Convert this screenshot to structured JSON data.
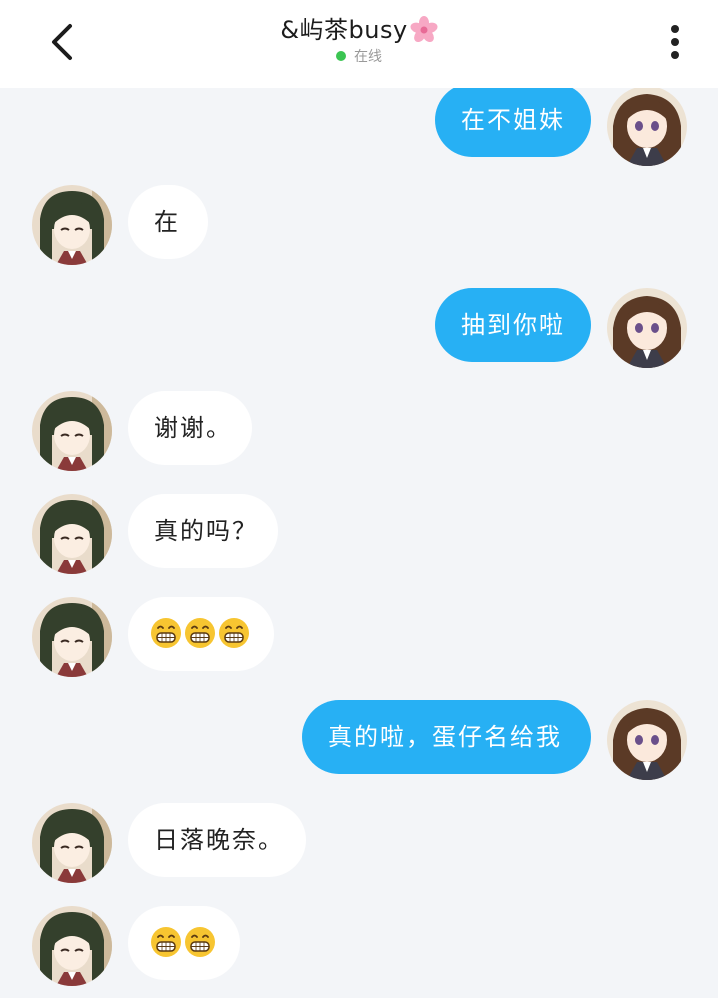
{
  "header": {
    "contact_name": "&屿茶busy",
    "status": "在线",
    "accent_online": "#3bc552",
    "icons": [
      "back-arrow-icon",
      "cherry-blossom-icon",
      "more-vertical-icon"
    ]
  },
  "messages": [
    {
      "side": "out",
      "text": "在不姐妹"
    },
    {
      "side": "in",
      "text": "在"
    },
    {
      "side": "out",
      "text": "抽到你啦"
    },
    {
      "side": "in",
      "text": "谢谢。"
    },
    {
      "side": "in",
      "text": "真的吗？"
    },
    {
      "side": "in",
      "text": "",
      "emoji": [
        "grinning-face-emoji",
        "grinning-face-emoji",
        "grinning-face-emoji"
      ]
    },
    {
      "side": "out",
      "text": "真的啦，蛋仔名给我"
    },
    {
      "side": "in",
      "text": "日落晚奈。"
    },
    {
      "side": "in",
      "text": "",
      "emoji": [
        "grinning-face-emoji",
        "grinning-face-emoji"
      ]
    }
  ],
  "colors": {
    "background": "#f3f5f8",
    "outgoing_bubble": "#27b0f4",
    "incoming_bubble": "#ffffff"
  }
}
